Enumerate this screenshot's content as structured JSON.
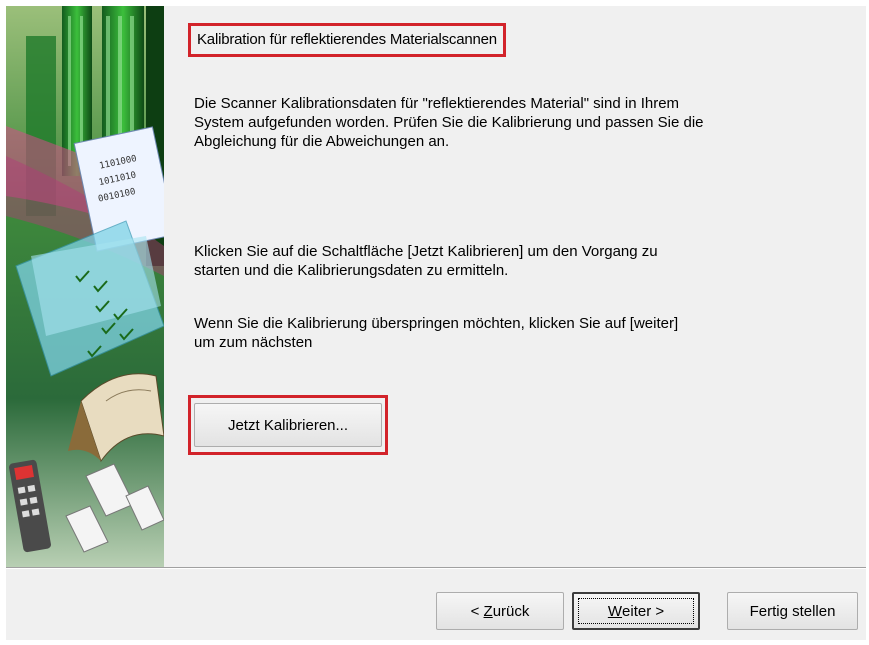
{
  "wizard": {
    "heading": "Kalibration für reflektierendes Materialscannen",
    "paragraph_1": "Die Scanner Kalibrationsdaten für \"reflektierendes Material\" sind in Ihrem\nSystem aufgefunden worden. Prüfen Sie die Kalibrierung und passen Sie die\nAbgleichung für die Abweichungen an.",
    "paragraph_2": "Klicken Sie auf die Schaltfläche [Jetzt Kalibrieren] um den Vorgang zu\nstarten und die Kalibrierungsdaten zu ermitteln.",
    "paragraph_3": "Wenn Sie die Kalibrierung überspringen möchten, klicken Sie auf [weiter]\num zum nächsten",
    "calibrate_button": "Jetzt Kalibrieren..."
  },
  "banner": {
    "digits": [
      "1101000",
      "1011010",
      "0010100"
    ],
    "icons": [
      "building-icon",
      "document-icon",
      "checklist-icon",
      "book-icon",
      "scanner-icon"
    ]
  },
  "footer": {
    "back": {
      "prefix": "< ",
      "mnemonic": "Z",
      "rest": "urück"
    },
    "next": {
      "mnemonic": "W",
      "rest": "eiter >"
    },
    "finish": "Fertig stellen"
  },
  "colors": {
    "highlight": "#d2232a",
    "dialog_bg": "#f0f0f0",
    "banner_green": "#2f8f3a",
    "banner_cyan": "#7fd3e6"
  }
}
